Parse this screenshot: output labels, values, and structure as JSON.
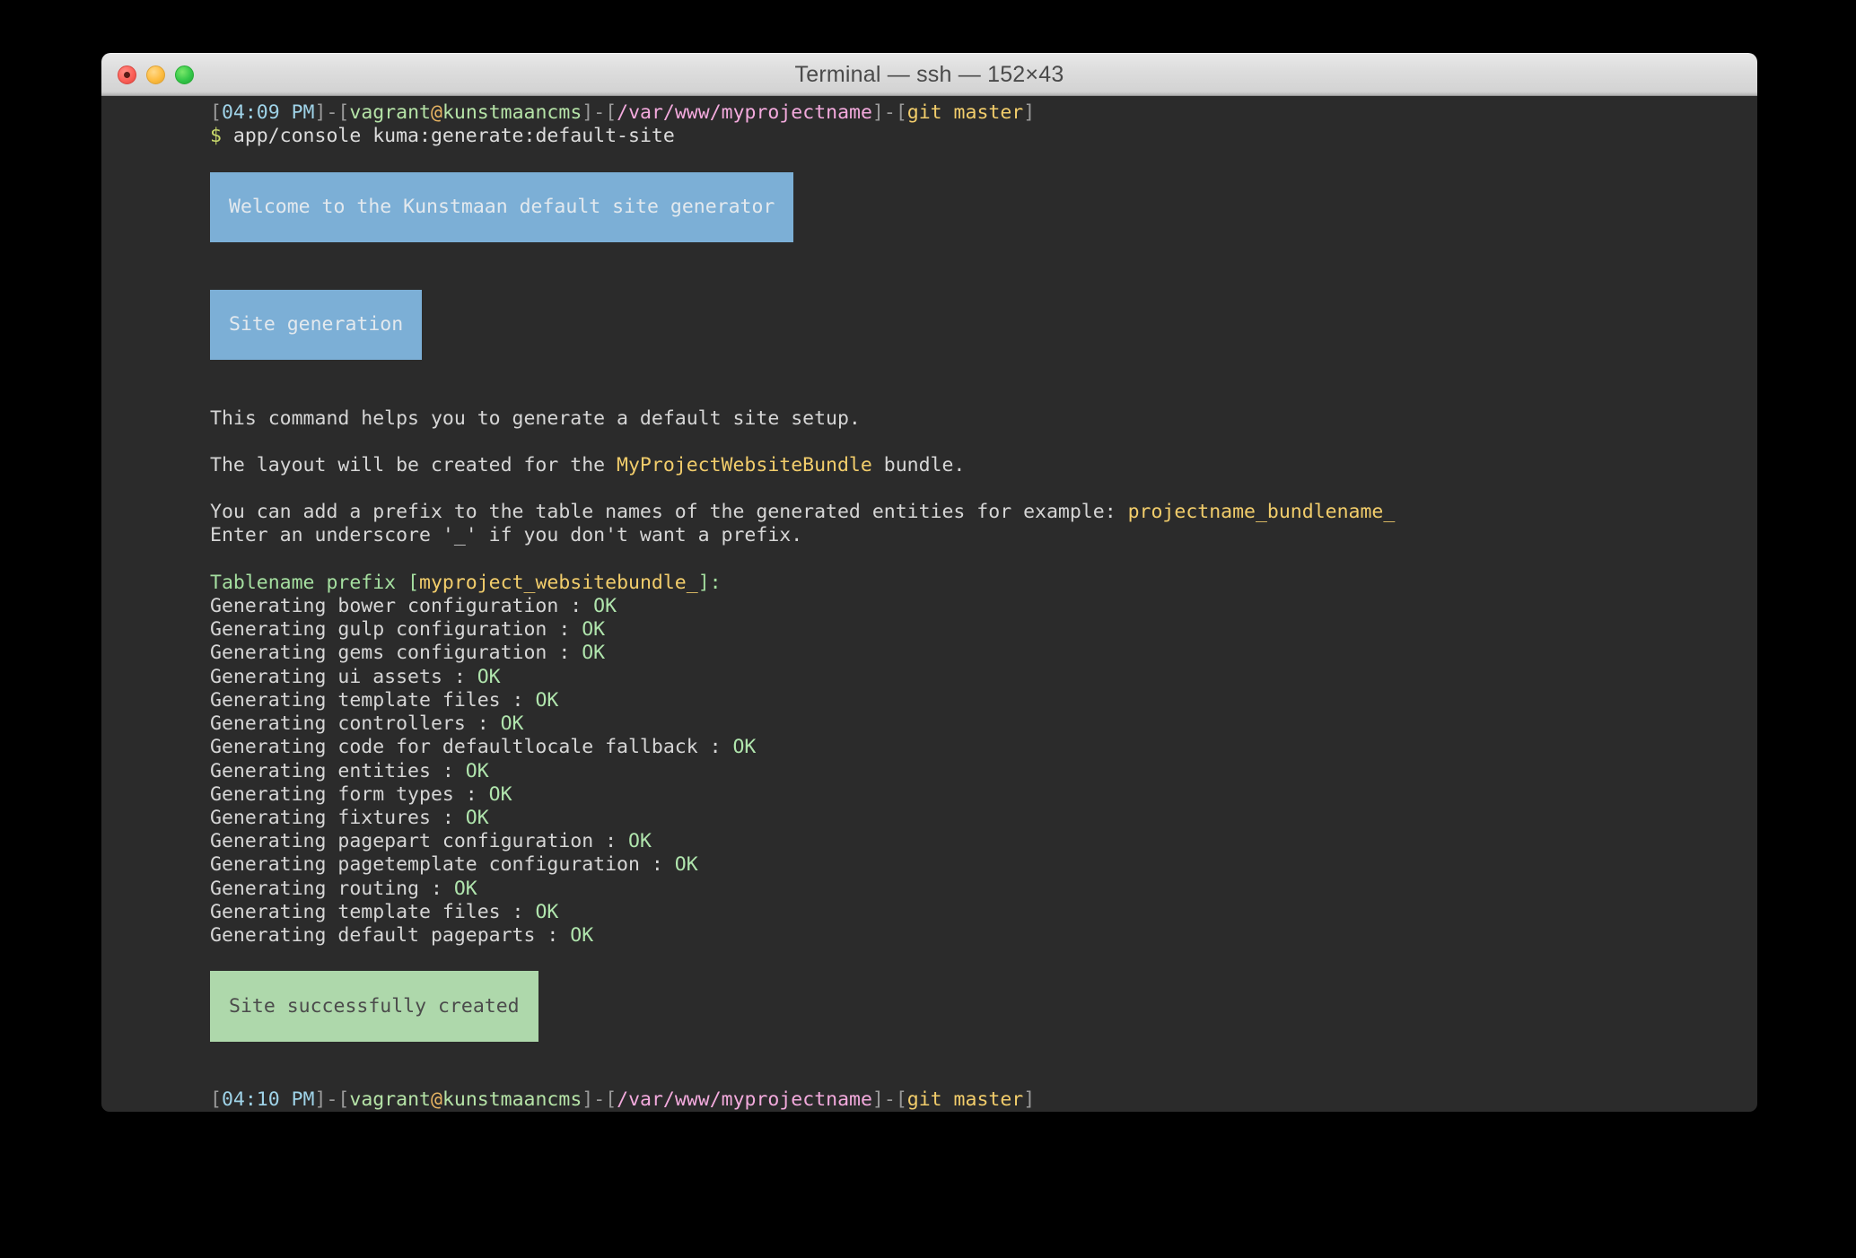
{
  "window": {
    "title": "Terminal — ssh — 152×43",
    "controls": [
      {
        "name": "close",
        "color": "#fb6058"
      },
      {
        "name": "minimize",
        "color": "#fdbc40"
      },
      {
        "name": "maximize",
        "color": "#34c749"
      }
    ]
  },
  "theme": {
    "background": "#2b2b2b",
    "foreground": "#d6d6d6",
    "time": "#9fd3e8",
    "user": "#b5e3a7",
    "at": "#e8b563",
    "path": "#f3aadd",
    "git": "#f2cd6b",
    "bracket": "#9a9a9a",
    "dollar": "#c9d96b",
    "ok": "#b0e5ad",
    "yellow": "#f2cd6b",
    "green": "#a5dfa0",
    "banner_blue_bg": "#7cafd6",
    "banner_blue_fg": "#e3e9ee",
    "banner_green_bg": "#aed8ab",
    "banner_green_fg": "#4b4b4b",
    "titlebar_fg": "#4a4a4a"
  },
  "prompt_top": {
    "time": "04:09 PM",
    "user": "vagrant",
    "at": "@",
    "host": "kunstmaancms",
    "path": "/var/www/myprojectname",
    "git": "git master",
    "open": "[",
    "close": "]",
    "dash": "-"
  },
  "command_line": {
    "dollar": "$",
    "command": " app/console kuma:generate:default-site"
  },
  "banner_welcome": {
    "text": "Welcome to the Kunstmaan default site generator"
  },
  "banner_section": {
    "text": "Site generation"
  },
  "body_lines": {
    "intro": "This command helps you to generate a default site setup.",
    "layout_pre": "The layout will be created for the ",
    "layout_bundle": "MyProjectWebsiteBundle",
    "layout_post": " bundle.",
    "prefix_pre": "You can add a prefix to the table names of the generated entities for example: ",
    "prefix_example": "projectname_bundlename_",
    "prefix_hint": "Enter an underscore '_' if you don't want a prefix."
  },
  "question": {
    "label": "Tablename prefix ",
    "open": "[",
    "default": "myproject_websitebundle_",
    "close": "]",
    "colon": ":"
  },
  "generating": [
    {
      "task": "Generating bower configuration : ",
      "status": "OK"
    },
    {
      "task": "Generating gulp configuration : ",
      "status": "OK"
    },
    {
      "task": "Generating gems configuration : ",
      "status": "OK"
    },
    {
      "task": "Generating ui assets : ",
      "status": "OK"
    },
    {
      "task": "Generating template files : ",
      "status": "OK"
    },
    {
      "task": "Generating controllers : ",
      "status": "OK"
    },
    {
      "task": "Generating code for defaultlocale fallback : ",
      "status": "OK"
    },
    {
      "task": "Generating entities : ",
      "status": "OK"
    },
    {
      "task": "Generating form types : ",
      "status": "OK"
    },
    {
      "task": "Generating fixtures : ",
      "status": "OK"
    },
    {
      "task": "Generating pagepart configuration : ",
      "status": "OK"
    },
    {
      "task": "Generating pagetemplate configuration : ",
      "status": "OK"
    },
    {
      "task": "Generating routing : ",
      "status": "OK"
    },
    {
      "task": "Generating template files : ",
      "status": "OK"
    },
    {
      "task": "Generating default pageparts : ",
      "status": "OK"
    }
  ],
  "banner_success": {
    "text": "Site successfully created"
  },
  "prompt_bottom": {
    "time": "04:10 PM",
    "user": "vagrant",
    "at": "@",
    "host": "kunstmaancms",
    "path": "/var/www/myprojectname",
    "git": "git master",
    "open": "[",
    "close": "]",
    "dash": "-"
  },
  "prompt_cursor": {
    "dollar": "$"
  }
}
